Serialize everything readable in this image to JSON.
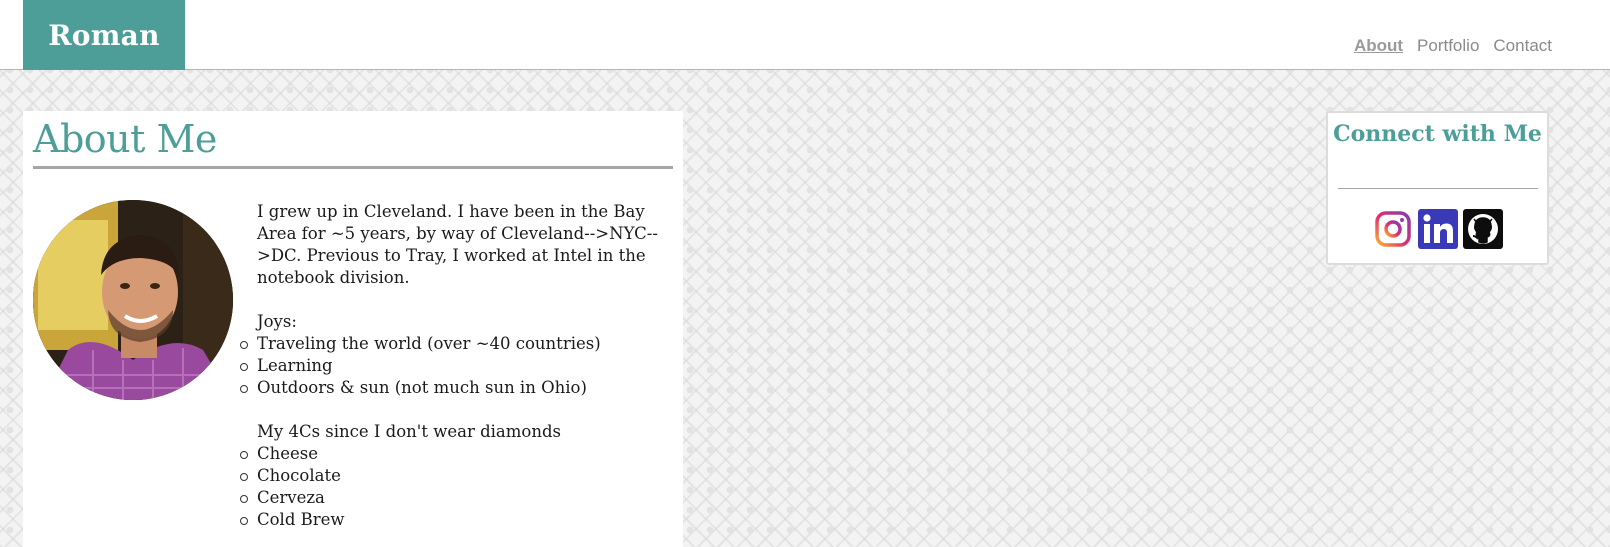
{
  "header": {
    "brand": "Roman",
    "nav": [
      {
        "label": "About",
        "active": true
      },
      {
        "label": "Portfolio",
        "active": false
      },
      {
        "label": "Contact",
        "active": false
      }
    ]
  },
  "about": {
    "title": "About Me",
    "intro": "I grew up in Cleveland. I have been in the Bay Area for ~5 years, by way of Cleveland-->NYC-->DC. Previous to Tray, I worked at Intel in the notebook division.",
    "joys_heading": "Joys:",
    "joys": [
      "Traveling the world (over ~40 countries)",
      "Learning",
      "Outdoors & sun (not much sun in Ohio)"
    ],
    "cs_heading": "My 4Cs since I don't wear diamonds",
    "cs": [
      "Cheese",
      "Chocolate",
      "Cerveza",
      "Cold Brew"
    ]
  },
  "connect": {
    "title": "Connect with Me",
    "icons": [
      "instagram-icon",
      "linkedin-icon",
      "github-icon"
    ]
  },
  "colors": {
    "accent": "#4d9e99",
    "nav_text": "#8b8b8b",
    "linkedin": "#3a3ab8"
  }
}
